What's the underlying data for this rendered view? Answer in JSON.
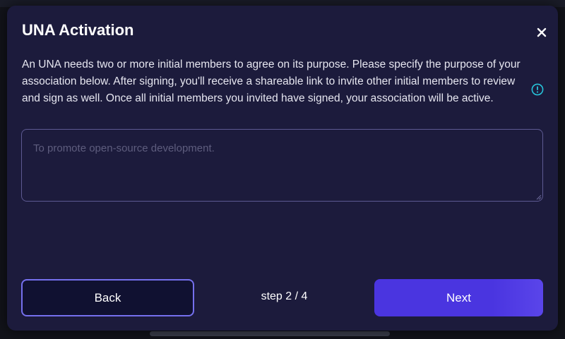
{
  "modal": {
    "title": "UNA Activation",
    "close_icon": "close-icon",
    "description": "An UNA needs two or more initial members to agree on its purpose. Please specify the purpose of your association below. After signing, you'll receive a shareable link to invite other initial members to review and sign as well. Once all initial members you invited have signed, your association will be active.",
    "info_icon": "info-icon",
    "purpose_input": {
      "value": "",
      "placeholder": "To promote open-source development."
    },
    "footer": {
      "back_label": "Back",
      "step_label": "step 2 / 4",
      "next_label": "Next"
    }
  },
  "colors": {
    "modal_background": "#1c1b3c",
    "accent": "#4a35e0",
    "back_border": "#7570ee",
    "info_icon": "#27c3d9"
  }
}
